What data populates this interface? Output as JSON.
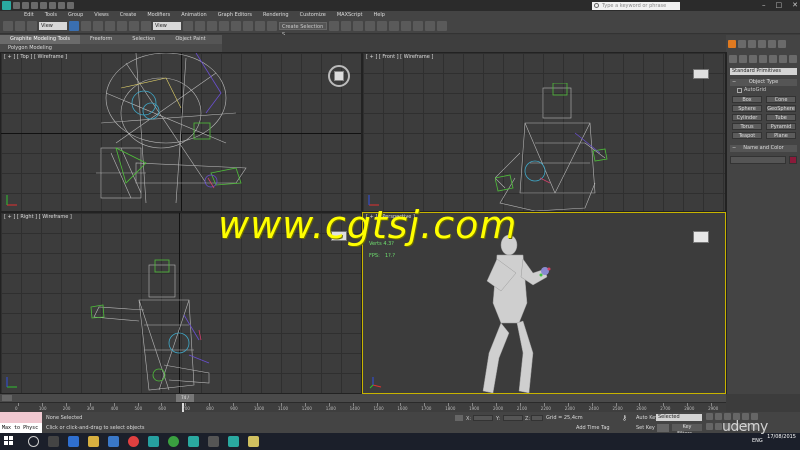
{
  "titlebar": {
    "search_placeholder": "Type a keyword or phrase"
  },
  "menu": [
    "Edit",
    "Tools",
    "Group",
    "Views",
    "Create",
    "Modifiers",
    "Animation",
    "Graph Editors",
    "Rendering",
    "Customize",
    "MAXScript",
    "Help"
  ],
  "toolbar": {
    "selection_filter": "View",
    "named_selection": "Create Selection S"
  },
  "ribbon": {
    "tabs": [
      "Graphite Modeling Tools",
      "Freeform",
      "Selection",
      "Object Paint"
    ],
    "subpanel": "Polygon Modeling"
  },
  "viewports": {
    "top_label": "[ + ] [ Top ] [ Wireframe ]",
    "front_label": "[ + ] [ Front ] [ Wireframe ]",
    "right_label": "[ + ] [ Right ] [ Wireframe ]",
    "persp_label": "[ + ] [ Perspective ]",
    "persp_stat1": "Verts  4.3?",
    "persp_fps_label": "FPS:",
    "persp_fps_value": "1?.?"
  },
  "watermark": "www.cgtsj.com",
  "command_panel": {
    "dropdown": "Standard Primitives",
    "object_type_title": "Object Type",
    "autogrid": "AutoGrid",
    "buttons": [
      "Box",
      "Cone",
      "Sphere",
      "GeoSphere",
      "Cylinder",
      "Tube",
      "Torus",
      "Pyramid",
      "Teapot",
      "Plane"
    ],
    "name_color_title": "Name and Color",
    "swatch_color": "#8a1a3a"
  },
  "timeslider": {
    "frame": "74 / 3000"
  },
  "trackbar_ticks": [
    "0",
    "100",
    "200",
    "300",
    "400",
    "500",
    "600",
    "700",
    "800",
    "900",
    "1000",
    "1100",
    "1200",
    "1300",
    "1400",
    "1500",
    "1600",
    "1700",
    "1800",
    "1900",
    "2000",
    "2100",
    "2200",
    "2300",
    "2400",
    "2500",
    "2600",
    "2700",
    "2800",
    "2900"
  ],
  "statusbar": {
    "maxscript": "Max to Physc",
    "selection": "None Selected",
    "prompt": "Click or click-and-drag to select objects",
    "x": "X:",
    "y": "Y:",
    "z": "Z:",
    "grid": "Grid = 25,4cm",
    "add_time_tag": "Add Time Tag",
    "auto_key": "Auto Key",
    "selected": "Selected",
    "set_key": "Set Key",
    "key_filters": "Key Filters..."
  },
  "taskbar": {
    "lang": "ENG",
    "date": "17/08/2015",
    "udemy": "udemy"
  }
}
